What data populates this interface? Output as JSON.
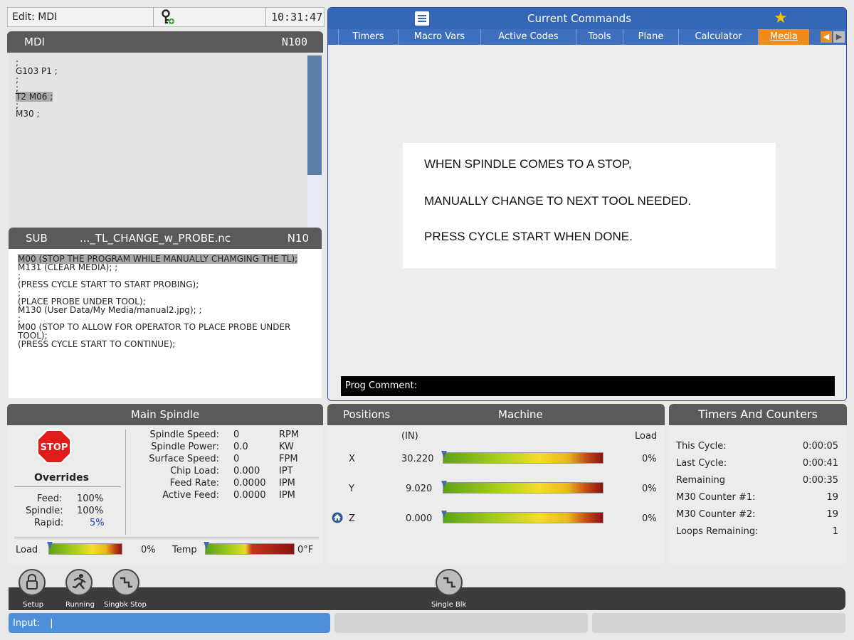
{
  "status": {
    "mode": "Edit: MDI",
    "time": "10:31:47"
  },
  "mdi": {
    "title": "MDI",
    "block": "N100",
    "lines": [
      ";",
      "G103 P1 ;",
      ";",
      ";",
      "T2 M06 ;",
      ";",
      "M30 ;"
    ]
  },
  "sub": {
    "title": "SUB",
    "file": "..._TL_CHANGE_w_PROBE.nc",
    "block": "N10",
    "lines": [
      "M00 (STOP THE PROGRAM WHILE MANUALLY CHAMGING THE TL);",
      "M131 (CLEAR MEDIA); ;",
      ";",
      "(PRESS CYCLE START TO START PROBING);",
      ";",
      "(PLACE PROBE UNDER TOOL);",
      "M130 (User Data/My Media/manual2.jpg); ;",
      ";",
      "M00 (STOP TO ALLOW FOR OPERATOR TO PLACE PROBE UNDER TOOL);",
      "(PRESS CYCLE START TO CONTINUE);"
    ]
  },
  "commands": {
    "title": "Current Commands",
    "tabs": [
      "Timers",
      "Macro Vars",
      "Active Codes",
      "Tools",
      "Plane",
      "Calculator",
      "Media"
    ],
    "active_tab": "Media",
    "media_lines": [
      "WHEN SPINDLE COMES TO A STOP,",
      "MANUALLY CHANGE TO NEXT TOOL NEEDED.",
      "PRESS CYCLE START WHEN DONE."
    ],
    "prog_comment_label": "Prog Comment:"
  },
  "spindle": {
    "title": "Main Spindle",
    "stop_label": "STOP",
    "overrides_label": "Overrides",
    "overrides": [
      {
        "label": "Feed:",
        "value": "100%"
      },
      {
        "label": "Spindle:",
        "value": "100%"
      },
      {
        "label": "Rapid:",
        "value": "5%"
      }
    ],
    "rows": [
      {
        "label": "Spindle Speed:",
        "value": "0",
        "unit": "RPM"
      },
      {
        "label": "Spindle Power:",
        "value": "0.0",
        "unit": "KW"
      },
      {
        "label": "Surface Speed:",
        "value": "0",
        "unit": "FPM"
      },
      {
        "label": "Chip Load:",
        "value": "0.000",
        "unit": "IPT"
      },
      {
        "label": "Feed Rate:",
        "value": "0.0000",
        "unit": "IPM"
      },
      {
        "label": "Active Feed:",
        "value": "0.0000",
        "unit": "IPM"
      }
    ],
    "load_label": "Load",
    "load_value": "0%",
    "temp_label": "Temp",
    "temp_value": "0°F"
  },
  "positions": {
    "title": "Positions",
    "mode": "Machine",
    "units": "(IN)",
    "load_header": "Load",
    "axes": [
      {
        "name": "X",
        "value": "30.220",
        "load": "0%"
      },
      {
        "name": "Y",
        "value": "9.020",
        "load": "0%"
      },
      {
        "name": "Z",
        "value": "0.000",
        "load": "0%"
      }
    ]
  },
  "timers": {
    "title": "Timers And Counters",
    "rows": [
      {
        "label": "This Cycle:",
        "value": "0:00:05"
      },
      {
        "label": "Last Cycle:",
        "value": "0:00:41"
      },
      {
        "label": "Remaining",
        "value": "0:00:35"
      },
      {
        "label": "M30 Counter #1:",
        "value": "19"
      },
      {
        "label": "M30 Counter #2:",
        "value": "19"
      },
      {
        "label": "Loops Remaining:",
        "value": "1"
      }
    ]
  },
  "toolbar": {
    "setup": "Setup",
    "running": "Running",
    "singbk_stop": "Singbk Stop",
    "single_blk": "Single Blk"
  },
  "input": {
    "label": "Input:",
    "value": "|"
  },
  "colors": {
    "accent": "#3466b5",
    "active_tab": "#f08c1c",
    "rapid_override": "#1a3ad6"
  }
}
